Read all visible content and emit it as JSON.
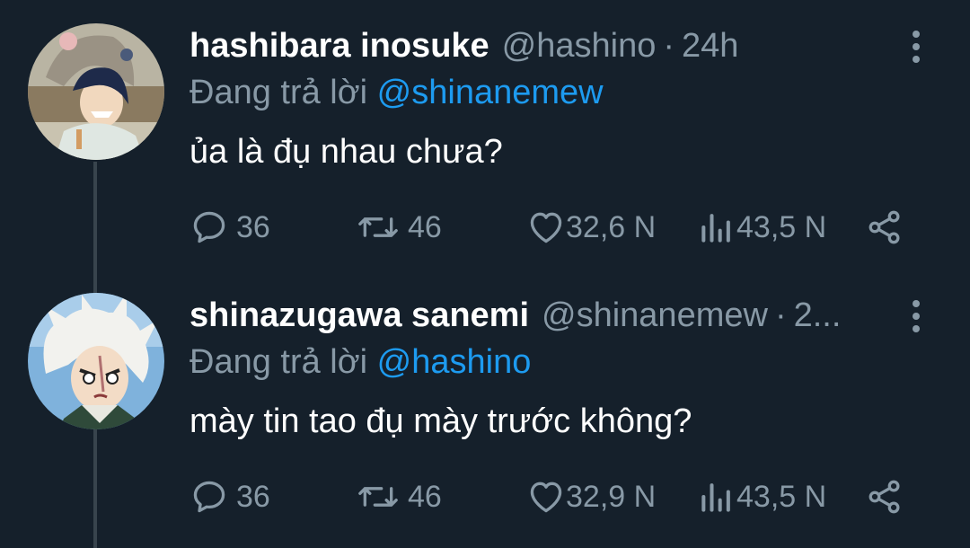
{
  "tweets": [
    {
      "name": "hashibara inosuke",
      "handle": "@hashino",
      "time": "24h",
      "reply_prefix": "Đang trả lời",
      "reply_mention": "@shinanemew",
      "text": "ủa là đụ nhau chưa?",
      "replies": "36",
      "retweets": "46",
      "likes": "32,6 N",
      "views": "43,5 N"
    },
    {
      "name": "shinazugawa sanemi",
      "handle": "@shinanemew",
      "time": "2...",
      "reply_prefix": "Đang trả lời",
      "reply_mention": "@hashino",
      "text": "mày tin tao đụ mày trước không?",
      "replies": "36",
      "retweets": "46",
      "likes": "32,9 N",
      "views": "43,5 N"
    }
  ],
  "icons": {
    "reply": "reply-icon",
    "retweet": "retweet-icon",
    "like": "heart-icon",
    "views": "views-icon",
    "share": "share-icon",
    "more": "more-vertical-icon"
  },
  "colors": {
    "background": "#15202b",
    "secondary_text": "#8899a6",
    "mention": "#1d9bf0",
    "thread_line": "#38444d"
  }
}
